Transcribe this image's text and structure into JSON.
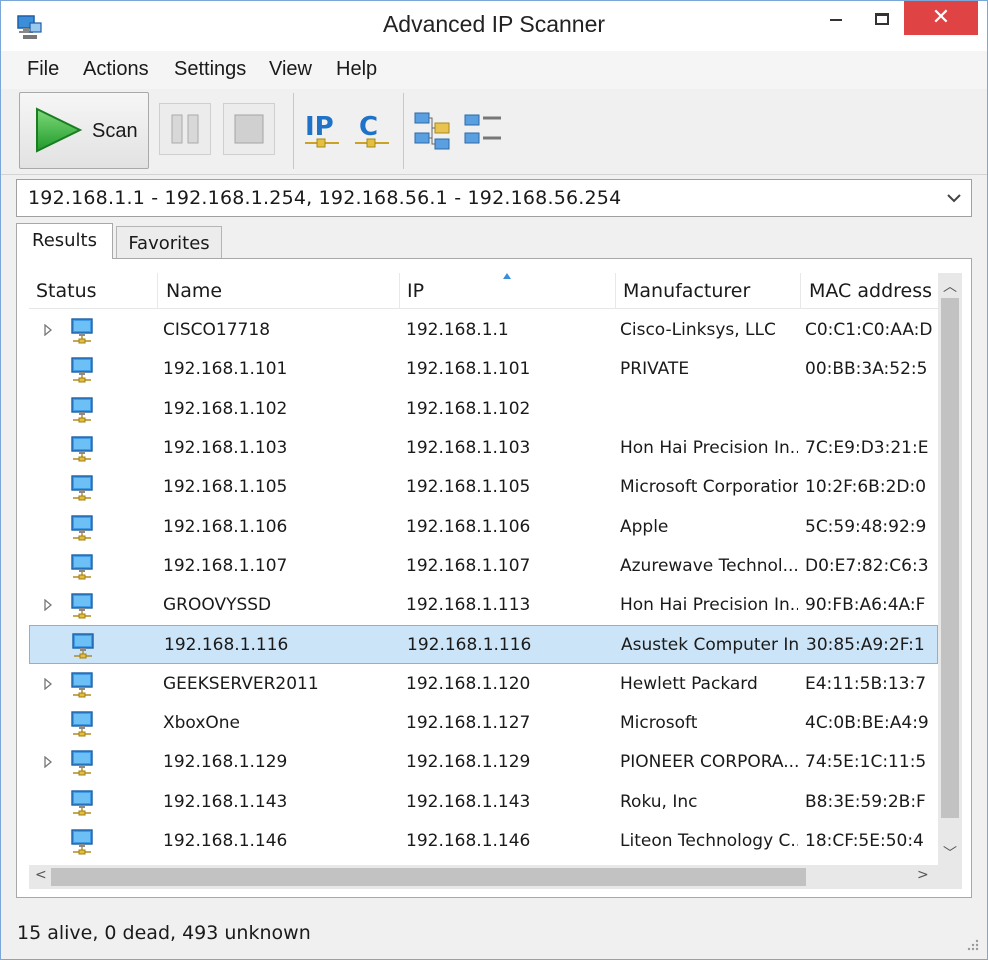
{
  "window": {
    "title": "Advanced IP Scanner"
  },
  "menu": [
    "File",
    "Actions",
    "Settings",
    "View",
    "Help"
  ],
  "toolbar": {
    "scan_label": "Scan",
    "buttons": [
      "play-icon",
      "pause-icon",
      "stop-icon",
      "ip-icon",
      "c-icon",
      "network-map-icon",
      "list-view-icon"
    ]
  },
  "range": {
    "value": "192.168.1.1 - 192.168.1.254, 192.168.56.1 - 192.168.56.254"
  },
  "tabs": [
    "Results",
    "Favorites"
  ],
  "columns": [
    "Status",
    "Name",
    "IP",
    "Manufacturer",
    "MAC address"
  ],
  "rows": [
    {
      "expandable": true,
      "name": "CISCO17718",
      "ip": "192.168.1.1",
      "manufacturer": "Cisco-Linksys, LLC",
      "mac": "C0:C1:C0:AA:D"
    },
    {
      "expandable": false,
      "name": "192.168.1.101",
      "ip": "192.168.1.101",
      "manufacturer": "PRIVATE",
      "mac": "00:BB:3A:52:5"
    },
    {
      "expandable": false,
      "name": "192.168.1.102",
      "ip": "192.168.1.102",
      "manufacturer": "",
      "mac": ""
    },
    {
      "expandable": false,
      "name": "192.168.1.103",
      "ip": "192.168.1.103",
      "manufacturer": "Hon Hai Precision In...",
      "mac": "7C:E9:D3:21:E"
    },
    {
      "expandable": false,
      "name": "192.168.1.105",
      "ip": "192.168.1.105",
      "manufacturer": "Microsoft Corporation",
      "mac": "10:2F:6B:2D:0"
    },
    {
      "expandable": false,
      "name": "192.168.1.106",
      "ip": "192.168.1.106",
      "manufacturer": "Apple",
      "mac": "5C:59:48:92:9"
    },
    {
      "expandable": false,
      "name": "192.168.1.107",
      "ip": "192.168.1.107",
      "manufacturer": "Azurewave Technol...",
      "mac": "D0:E7:82:C6:3"
    },
    {
      "expandable": true,
      "name": "GROOVYSSD",
      "ip": "192.168.1.113",
      "manufacturer": "Hon Hai Precision In...",
      "mac": "90:FB:A6:4A:F"
    },
    {
      "expandable": false,
      "name": "192.168.1.116",
      "ip": "192.168.1.116",
      "manufacturer": "Asustek Computer Inc",
      "mac": "30:85:A9:2F:1",
      "selected": true
    },
    {
      "expandable": true,
      "name": "GEEKSERVER2011",
      "ip": "192.168.1.120",
      "manufacturer": "Hewlett Packard",
      "mac": "E4:11:5B:13:7"
    },
    {
      "expandable": false,
      "name": "XboxOne",
      "ip": "192.168.1.127",
      "manufacturer": "Microsoft",
      "mac": "4C:0B:BE:A4:9"
    },
    {
      "expandable": true,
      "name": "192.168.1.129",
      "ip": "192.168.1.129",
      "manufacturer": "PIONEER CORPORA...",
      "mac": "74:5E:1C:11:5"
    },
    {
      "expandable": false,
      "name": "192.168.1.143",
      "ip": "192.168.1.143",
      "manufacturer": "Roku, Inc",
      "mac": "B8:3E:59:2B:F"
    },
    {
      "expandable": false,
      "name": "192.168.1.146",
      "ip": "192.168.1.146",
      "manufacturer": "Liteon Technology C...",
      "mac": "18:CF:5E:50:4"
    }
  ],
  "status": {
    "text": "15 alive, 0 dead, 493 unknown"
  },
  "colors": {
    "selection": "#cce4f7",
    "accent": "#1e73c8",
    "close": "#e04343"
  }
}
